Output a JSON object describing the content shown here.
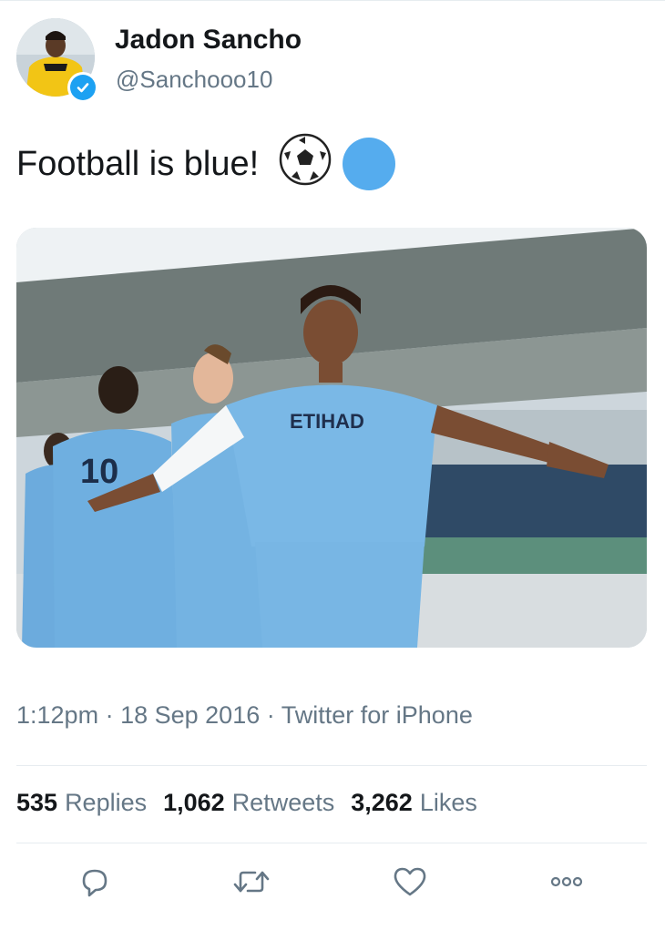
{
  "user": {
    "name": "Jadon Sancho",
    "handle": "@Sanchooo10",
    "verified": true
  },
  "tweet": {
    "text": "Football is blue!",
    "emoji": [
      "soccer-ball-icon",
      "blue-circle-icon"
    ]
  },
  "meta": {
    "time": "1:12pm",
    "sep1": "·",
    "date": "18 Sep 2016",
    "sep2": "·",
    "source": "Twitter for iPhone"
  },
  "stats": {
    "replies_count": "535",
    "replies_label": "Replies",
    "retweets_count": "1,062",
    "retweets_label": "Retweets",
    "likes_count": "3,262",
    "likes_label": "Likes"
  },
  "actions": [
    "reply-icon",
    "retweet-icon",
    "like-icon",
    "more-icon"
  ],
  "colors": {
    "text": "#14171a",
    "secondary": "#657786",
    "divider": "#e6ecf0",
    "verified": "#1da1f2",
    "blue_circle": "#55acee",
    "kit": "#6cabdd"
  }
}
